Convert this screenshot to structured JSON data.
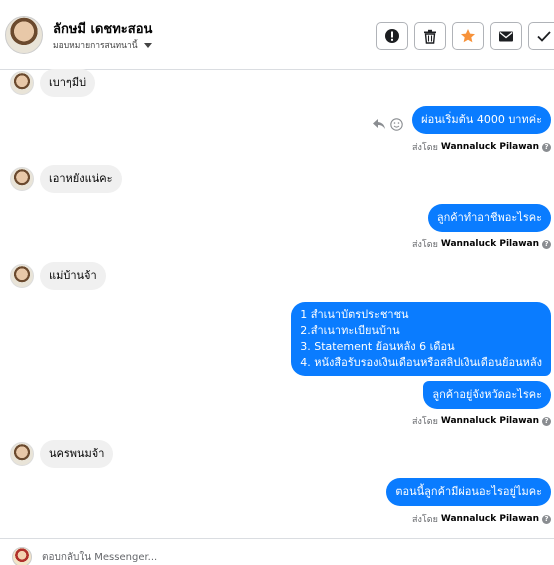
{
  "header": {
    "contact_name": "ลักษมี เดชทะสอน",
    "assign_label": "มอบหมายการสนทนานี้",
    "buttons": {
      "alert_icon": "exclamation-circle-icon",
      "trash_icon": "trash-icon",
      "star_icon": "star-icon",
      "mail_icon": "envelope-icon",
      "done_icon": "check-icon"
    }
  },
  "colors": {
    "outgoing_bubble": "#0a7cff",
    "incoming_bubble": "#f0f0f0",
    "star": "#f7923a"
  },
  "messages": [
    {
      "direction": "in",
      "text": "เบาๆมีบ่"
    },
    {
      "direction": "out",
      "text": "ผ่อนเริ่มต้น 4000 บาทค่ะ",
      "sent_by_prefix": "ส่งโดย",
      "sent_by_name": "Wannaluck Pilawan"
    },
    {
      "direction": "in",
      "text": "เอาหยังแน่คะ"
    },
    {
      "direction": "out",
      "text": "ลูกค้าทำอาชีพอะไรคะ",
      "sent_by_prefix": "ส่งโดย",
      "sent_by_name": "Wannaluck Pilawan"
    },
    {
      "direction": "in",
      "text": "แม่บ้านจ้า"
    },
    {
      "direction": "out",
      "lines": [
        "1 สำเนาบัตรประชาชน",
        "2.สำเนาทะเบียนบ้าน",
        " 3. Statement ย้อนหลัง 6 เดือน",
        "4. หนังสือรับรองเงินเดือนหรือสลิปเงินเดือนย้อนหลัง"
      ]
    },
    {
      "direction": "out",
      "text": "ลูกค้าอยู่จังหวัดอะไรคะ",
      "sent_by_prefix": "ส่งโดย",
      "sent_by_name": "Wannaluck Pilawan"
    },
    {
      "direction": "in",
      "text": "นครพนมจ้า"
    },
    {
      "direction": "out",
      "text": "ตอนนี้ลูกค้ามีผ่อนอะไรอยู่ไมคะ",
      "sent_by_prefix": "ส่งโดย",
      "sent_by_name": "Wannaluck Pilawan"
    }
  ],
  "composer": {
    "placeholder": "ตอบกลับใน Messenger..."
  }
}
